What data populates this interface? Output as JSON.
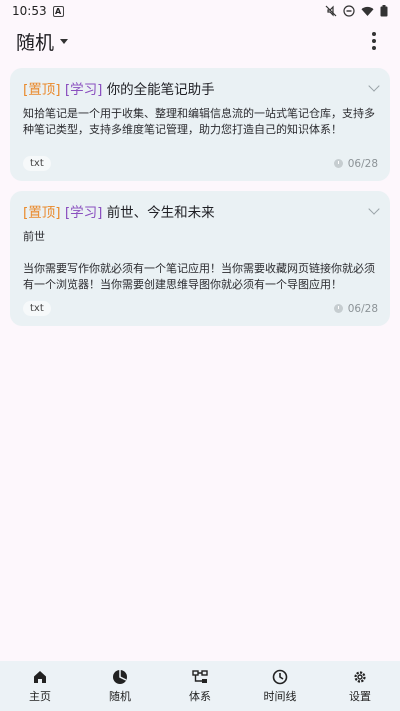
{
  "status_bar": {
    "time": "10:53",
    "a_icon_letter": "A"
  },
  "app_bar": {
    "title": "随机"
  },
  "notes": [
    {
      "tags": [
        "[置顶]",
        "[学习]"
      ],
      "title": "你的全能笔记助手",
      "body": "知拾笔记是一个用于收集、整理和编辑信息流的一站式笔记仓库，支持多种笔记类型，支持多维度笔记管理，助力您打造自己的知识体系！",
      "type": "txt",
      "date": "06/28"
    },
    {
      "tags": [
        "[置顶]",
        "[学习]"
      ],
      "title": "前世、今生和未来",
      "body": "前世\n\n当你需要写作你就必须有一个笔记应用！当你需要收藏网页链接你就必须有一个浏览器！当你需要创建思维导图你就必须有一个导图应用！",
      "type": "txt",
      "date": "06/28"
    }
  ],
  "bottom_nav": [
    {
      "label": "主页",
      "icon": "home-icon"
    },
    {
      "label": "随机",
      "icon": "random-icon"
    },
    {
      "label": "体系",
      "icon": "hierarchy-icon"
    },
    {
      "label": "时间线",
      "icon": "clock-icon"
    },
    {
      "label": "设置",
      "icon": "gear-icon"
    }
  ]
}
